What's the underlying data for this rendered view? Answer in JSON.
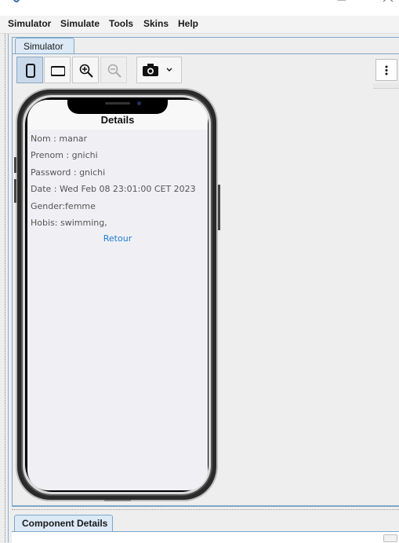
{
  "menubar": {
    "items": [
      "Simulator",
      "Simulate",
      "Tools",
      "Skins",
      "Help"
    ]
  },
  "tabs": {
    "simulator": "Simulator",
    "component_details": "Component Details"
  },
  "toolbar": {
    "buttons": [
      "portrait-icon",
      "landscape-icon",
      "zoom-in-icon",
      "zoom-out-icon",
      "camera-icon",
      "chevron-down-icon",
      "more-vert-icon"
    ]
  },
  "app": {
    "form_title": "Details",
    "fields": [
      "Nom : manar",
      "Prenom : gnichi",
      "Password : gnichi",
      "Date : Wed Feb 08 23:01:00 CET 2023",
      "Gender:femme",
      "Hobis: swimming,"
    ],
    "back_label": "Retour"
  },
  "colors": {
    "accent": "#1e7cd6",
    "tab_bg": "#dce9f6",
    "border_blue": "#7fa7c9"
  }
}
